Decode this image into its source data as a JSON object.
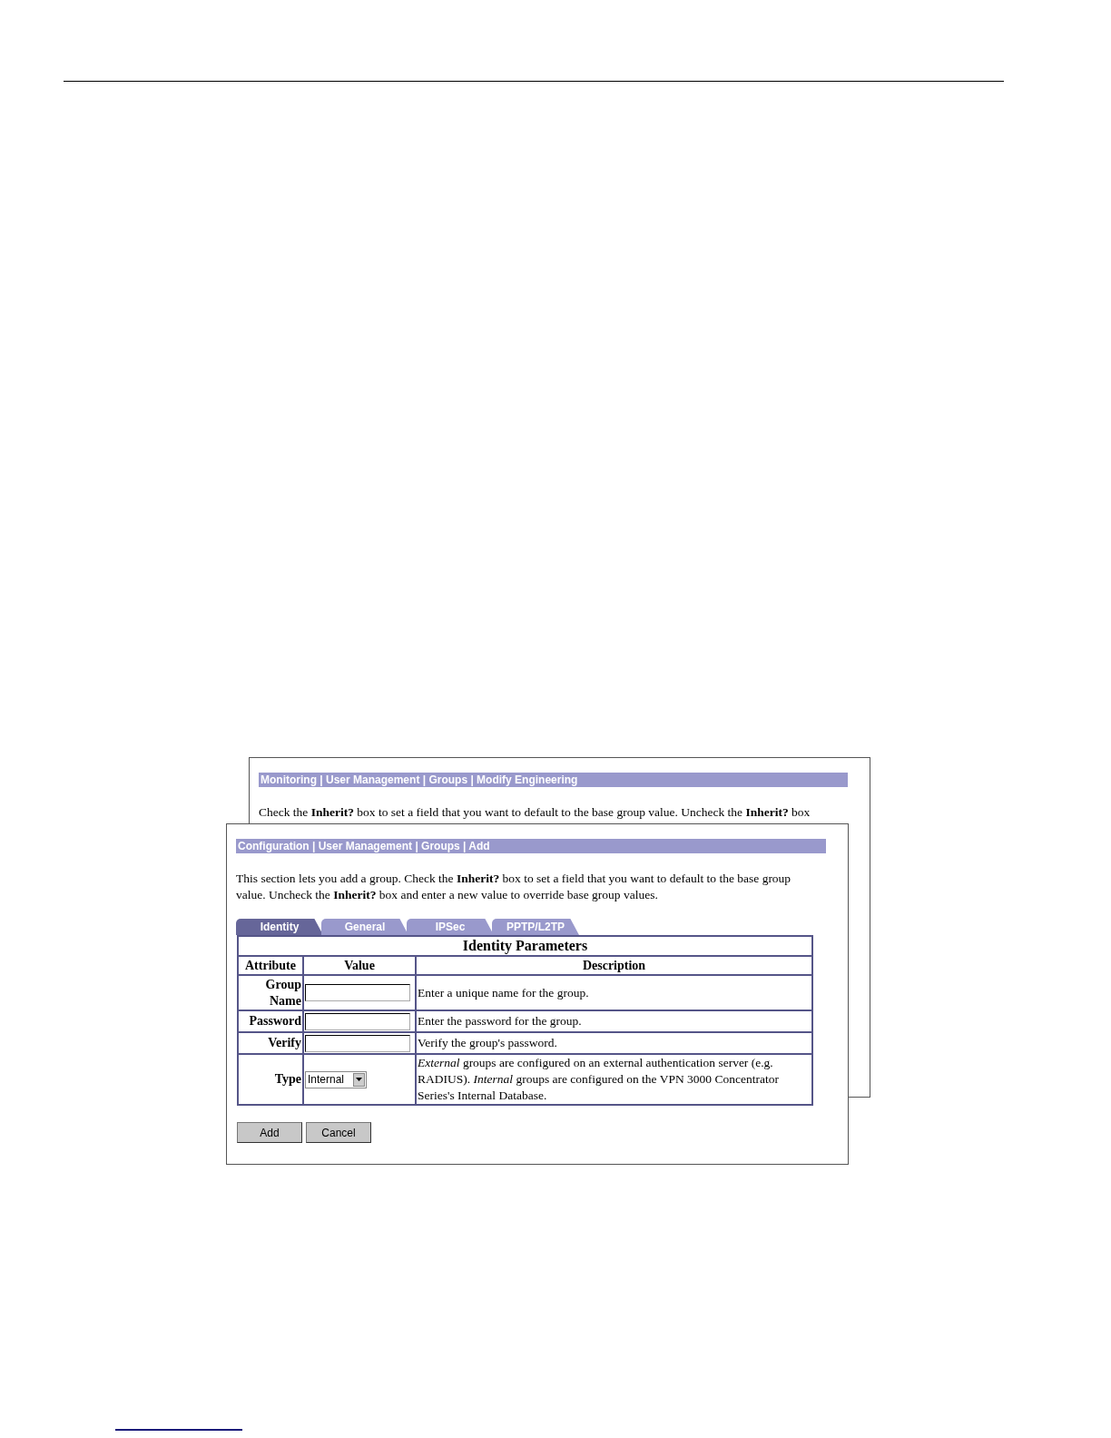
{
  "back_window": {
    "breadcrumb": "Monitoring | User Management | Groups | Modify Engineering",
    "intro": "Check the **Inherit?** box to set a field that you want to default to the base group value. Uncheck the **Inherit?** box"
  },
  "front_window": {
    "breadcrumb": "Configuration | User Management | Groups | Add",
    "intro": "This section lets you add a group. Check the **Inherit?** box to set a field that you want to default to the base group value. Uncheck the **Inherit?** box and enter a new value to override base group values.",
    "tabs": [
      {
        "label": "Identity",
        "selected": true
      },
      {
        "label": "General",
        "selected": false
      },
      {
        "label": "IPSec",
        "selected": false
      },
      {
        "label": "PPTP/L2TP",
        "selected": false
      }
    ],
    "table": {
      "title": "Identity Parameters",
      "columns": [
        "Attribute",
        "Value",
        "Description"
      ],
      "rows": [
        {
          "attribute": "Group Name",
          "kind": "text",
          "description": "Enter a unique name for the group."
        },
        {
          "attribute": "Password",
          "kind": "text",
          "description": "Enter the password for the group."
        },
        {
          "attribute": "Verify",
          "kind": "text",
          "description": "Verify the group's password."
        },
        {
          "attribute": "Type",
          "kind": "select",
          "value": "Internal",
          "description": "*External* groups are configured on an external authentication server (e.g. RADIUS). *Internal* groups are configured on the VPN 3000 Concentrator Series's Internal Database."
        }
      ]
    },
    "buttons": [
      "Add",
      "Cancel"
    ]
  }
}
